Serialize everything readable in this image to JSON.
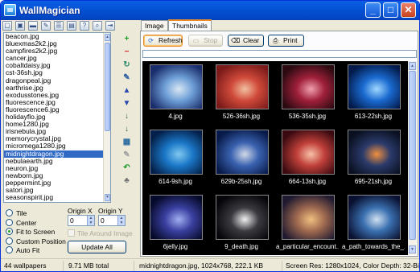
{
  "window": {
    "title": "WallMagician"
  },
  "titlebar_buttons": {
    "minimize": "_",
    "maximize": "□",
    "close": "✕"
  },
  "toolbar": {
    "icons": [
      "new-icon",
      "open-icon",
      "save-icon",
      "edit-icon",
      "list-icon",
      "image-icon",
      "help-icon",
      "search-icon",
      "exit-icon"
    ]
  },
  "files": [
    "beacon.jpg",
    "bluexmas2k2.jpg",
    "campfires2k2.jpg",
    "cancer.jpg",
    "cobaltdaisy.jpg",
    "cst-36sh.jpg",
    "dragonpeal.jpg",
    "earthrise.jpg",
    "exodusstones.jpg",
    "fluorescence.jpg",
    "fluorescence6.jpg",
    "holidayflo.jpg",
    "home1280.jpg",
    "irisnebula.jpg",
    "memorycrystal.jpg",
    "micromega1280.jpg",
    "midnightdragon.jpg",
    "nebulaearth.jpg",
    "neuron.jpg",
    "newborn.jpg",
    "peppermint.jpg",
    "satori.jpg",
    "seasonspirit.jpg"
  ],
  "selected_file": "midnightdragon.jpg",
  "side_buttons": [
    "+",
    "−",
    "↻",
    "✎",
    "▲",
    "▼",
    "↓",
    "↓",
    "▦",
    "✎",
    "↶",
    "♣"
  ],
  "positioning": {
    "options": [
      "Tile",
      "Center",
      "Fit to Screen",
      "Custom Position",
      "Auto Fit"
    ],
    "selected": "Fit to Screen",
    "origin_x_label": "Origin X",
    "origin_y_label": "Origin Y",
    "origin_x": "0",
    "origin_y": "0",
    "tile_around_label": "Tile Around Image",
    "update_label": "Update All"
  },
  "tabs": [
    "Image",
    "Thumbnails"
  ],
  "active_tab": "Thumbnails",
  "thumb_buttons": {
    "refresh": "Refresh",
    "stop": "Stop",
    "clear": "Clear",
    "print": "Print"
  },
  "thumbnails": [
    {
      "name": "4.jpg",
      "colors": [
        "#1a2d6b",
        "#6fa0d8",
        "#d9e6f2"
      ]
    },
    {
      "name": "526-36sh.jpg",
      "colors": [
        "#7a1a1a",
        "#d04a3a",
        "#f2c0a0"
      ]
    },
    {
      "name": "536-35sh.jpg",
      "colors": [
        "#2a0a10",
        "#a0203a",
        "#f0a0b0"
      ]
    },
    {
      "name": "613-22sh.jpg",
      "colors": [
        "#031a4a",
        "#1a6ad0",
        "#a0d8ff"
      ]
    },
    {
      "name": "614-9sh.jpg",
      "colors": [
        "#04204a",
        "#1b78c8",
        "#80c8f0"
      ]
    },
    {
      "name": "629b-25sh.jpg",
      "colors": [
        "#081a4a",
        "#3a62b0",
        "#d0d8e8"
      ]
    },
    {
      "name": "664-13sh.jpg",
      "colors": [
        "#3a0a10",
        "#c0403a",
        "#f8c0a8"
      ]
    },
    {
      "name": "695-21sh.jpg",
      "colors": [
        "#0a1020",
        "#2a3a6a",
        "#f09040"
      ]
    },
    {
      "name": "6jelly.jpg",
      "colors": [
        "#060a2a",
        "#3a40a0",
        "#a0b0f0"
      ]
    },
    {
      "name": "9_death.jpg",
      "colors": [
        "#05050a",
        "#3a3a40",
        "#f0f0f0"
      ]
    },
    {
      "name": "a_particular_encount...",
      "colors": [
        "#201a30",
        "#a06a50",
        "#f0c080"
      ]
    },
    {
      "name": "a_path_towards_the_...",
      "colors": [
        "#0a1030",
        "#3a70b0",
        "#d0e0f0"
      ]
    }
  ],
  "status": {
    "count": "44 wallpapers",
    "total": "9.71 MB total",
    "current": "midnightdragon.jpg, 1024x768, 222.1 KB",
    "screen": "Screen Res: 1280x1024, Color Depth: 32-Bit"
  }
}
